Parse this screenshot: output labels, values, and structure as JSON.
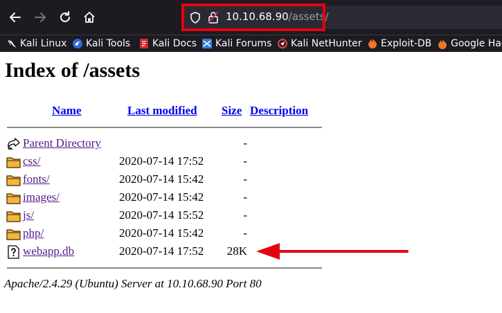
{
  "browser": {
    "url_host": "10.10.68.90",
    "url_path": "/assets/",
    "bookmarks": [
      {
        "label": "Kali Linux",
        "icon": "kali-dragon-icon"
      },
      {
        "label": "Kali Tools",
        "icon": "kali-tools-icon"
      },
      {
        "label": "Kali Docs",
        "icon": "kali-docs-icon"
      },
      {
        "label": "Kali Forums",
        "icon": "kali-forums-icon"
      },
      {
        "label": "Kali NetHunter",
        "icon": "nethunter-icon"
      },
      {
        "label": "Exploit-DB",
        "icon": "exploit-db-icon"
      },
      {
        "label": "Google Hac",
        "icon": "google-hacking-icon"
      }
    ]
  },
  "page": {
    "title": "Index of /assets",
    "headers": {
      "name": "Name",
      "last_modified": "Last modified",
      "size": "Size",
      "description": "Description"
    },
    "entries": [
      {
        "name": "Parent Directory",
        "date": "",
        "size": "-",
        "icon": "back-folder-icon"
      },
      {
        "name": "css/",
        "date": "2020-07-14 17:52",
        "size": "-",
        "icon": "folder-icon"
      },
      {
        "name": "fonts/",
        "date": "2020-07-14 15:42",
        "size": "-",
        "icon": "folder-icon"
      },
      {
        "name": "images/",
        "date": "2020-07-14 15:42",
        "size": "-",
        "icon": "folder-icon"
      },
      {
        "name": "js/",
        "date": "2020-07-14 15:52",
        "size": "-",
        "icon": "folder-icon"
      },
      {
        "name": "php/",
        "date": "2020-07-14 15:42",
        "size": "-",
        "icon": "folder-icon"
      },
      {
        "name": "webapp.db",
        "date": "2020-07-14 17:52",
        "size": "28K",
        "icon": "unknown-file-icon"
      }
    ],
    "address": "Apache/2.4.29 (Ubuntu) Server at 10.10.68.90 Port 80"
  },
  "annotations": {
    "highlight_color": "#e8000f"
  }
}
